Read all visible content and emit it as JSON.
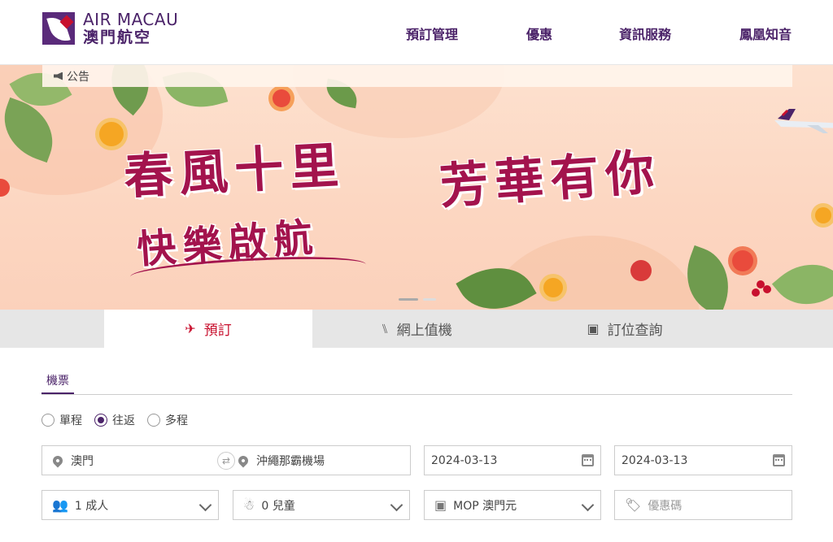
{
  "brand": {
    "name_en": "AIR MACAU",
    "name_zh": "澳門航空"
  },
  "nav": [
    "預訂管理",
    "優惠",
    "資訊服務",
    "鳳凰知音"
  ],
  "announcement": {
    "label": "公告"
  },
  "banner": {
    "line1": "春風十里",
    "line2": "芳華有你",
    "line3": "快樂啟航"
  },
  "tabs": [
    {
      "label": "預訂",
      "icon": "plane-icon"
    },
    {
      "label": "網上值機",
      "icon": "seat-icon"
    },
    {
      "label": "訂位查詢",
      "icon": "clipboard-icon"
    }
  ],
  "subtab": "機票",
  "trip_types": [
    {
      "label": "單程",
      "checked": false
    },
    {
      "label": "往返",
      "checked": true
    },
    {
      "label": "多程",
      "checked": false
    }
  ],
  "search": {
    "origin": "澳門",
    "destination": "沖繩那霸機場",
    "depart_date": "2024-03-13",
    "return_date": "2024-03-13",
    "adults": "1 成人",
    "children": "0 兒童",
    "currency": "MOP 澳門元",
    "promo_placeholder": "優惠碼"
  },
  "colors": {
    "brand_purple": "#4b2369",
    "accent_red": "#c8102e",
    "headline": "#a3134d"
  }
}
